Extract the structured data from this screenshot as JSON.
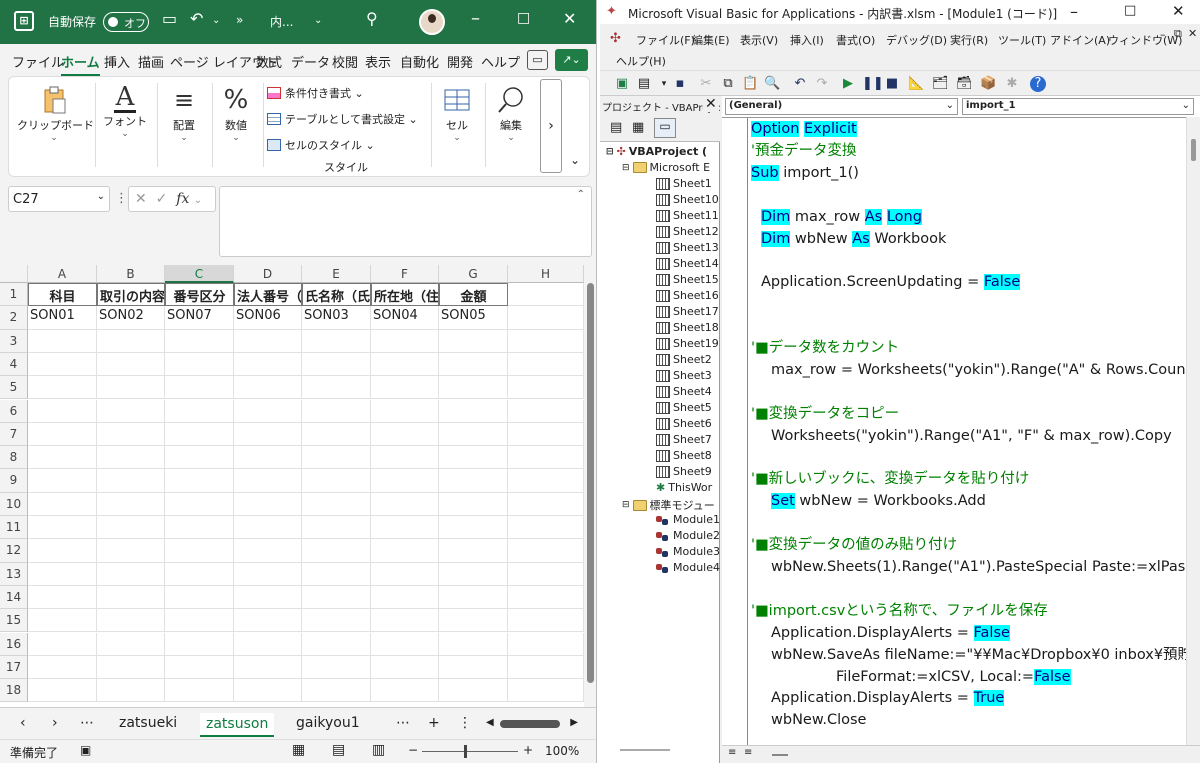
{
  "excel": {
    "logo_glyph": "⊞",
    "autosave_label": "自動保存",
    "autosave_state": "オフ",
    "title_short": "内...",
    "ribbon_tabs": [
      "ファイル",
      "ホーム",
      "挿入",
      "描画",
      "ページ レイアウト",
      "数式",
      "データ",
      "校閲",
      "表示",
      "自動化",
      "開発",
      "ヘルプ"
    ],
    "active_tab": "ホーム",
    "ribbon": {
      "clipboard": "クリップボード",
      "font": "フォント",
      "alignment": "配置",
      "number": "数値",
      "cond_format": "条件付き書式 ⌄",
      "table_format": "テーブルとして書式設定 ⌄",
      "cell_styles": "セルのスタイル ⌄",
      "styles_group": "スタイル",
      "cells": "セル",
      "editing": "編集"
    },
    "name_box": "C27",
    "fx_label": "fx",
    "columns": [
      "A",
      "B",
      "C",
      "D",
      "E",
      "F",
      "G",
      "H"
    ],
    "selected_column": "C",
    "rows": [
      "1",
      "2",
      "3",
      "4",
      "5",
      "6",
      "7",
      "8",
      "9",
      "10",
      "11",
      "12",
      "13",
      "14",
      "15",
      "16",
      "17",
      "18"
    ],
    "row1": [
      "科目",
      "取引の内容",
      "番号区分",
      "法人番号（法人",
      "氏名称（氏",
      "所在地（住",
      "金額"
    ],
    "row2": [
      "SON01",
      "SON02",
      "SON07",
      "SON06",
      "SON03",
      "SON04",
      "SON05"
    ],
    "sheet_tabs": [
      "zatsueki",
      "zatsuson",
      "gaikyou1"
    ],
    "active_sheet": "zatsuson",
    "status": "準備完了",
    "zoom": "100%"
  },
  "vba": {
    "title": "Microsoft Visual Basic for Applications - 内訳書.xlsm - [Module1 (コード)]",
    "menu_row1": [
      "ファイル(F)",
      "編集(E)",
      "表示(V)",
      "挿入(I)",
      "書式(O)",
      "デバッグ(D)",
      "実行(R)",
      "ツール(T)",
      "アドイン(A)",
      "ウィンドウ(W)"
    ],
    "menu_row2": [
      "ヘルプ(H)"
    ],
    "project_title": "プロジェクト - VBAProject",
    "tree": {
      "root": "VBAProject (",
      "excel_objects": "Microsoft E",
      "sheets": [
        "Sheet1",
        "Sheet10",
        "Sheet11",
        "Sheet12",
        "Sheet13",
        "Sheet14",
        "Sheet15",
        "Sheet16",
        "Sheet17",
        "Sheet18",
        "Sheet19",
        "Sheet2",
        "Sheet3",
        "Sheet4",
        "Sheet5",
        "Sheet6",
        "Sheet7",
        "Sheet8",
        "Sheet9",
        "ThisWor"
      ],
      "modules_folder": "標準モジュー",
      "modules": [
        "Module1",
        "Module2",
        "Module3",
        "Module4"
      ]
    },
    "object_combo": "(General)",
    "proc_combo": "import_1",
    "code_lines": [
      {
        "i": 0,
        "parts": [
          [
            "kw",
            "Option"
          ],
          [
            "t",
            " "
          ],
          [
            "kw",
            "Explicit"
          ]
        ]
      },
      {
        "i": 0,
        "parts": [
          [
            "cm",
            "'預金データ変換"
          ]
        ]
      },
      {
        "i": 0,
        "parts": [
          [
            "kw",
            "Sub"
          ],
          [
            "t",
            " import_1()"
          ]
        ]
      },
      {
        "i": 0,
        "parts": []
      },
      {
        "i": 1,
        "parts": [
          [
            "kw",
            "Dim"
          ],
          [
            "t",
            " max_row "
          ],
          [
            "kw",
            "As"
          ],
          [
            "t",
            " "
          ],
          [
            "kw",
            "Long"
          ]
        ]
      },
      {
        "i": 1,
        "parts": [
          [
            "kw",
            "Dim"
          ],
          [
            "t",
            " wbNew "
          ],
          [
            "kw",
            "As"
          ],
          [
            "t",
            " Workbook"
          ]
        ]
      },
      {
        "i": 0,
        "parts": []
      },
      {
        "i": 1,
        "parts": [
          [
            "t",
            "Application.ScreenUpdating = "
          ],
          [
            "kw",
            "False"
          ]
        ]
      },
      {
        "i": 0,
        "parts": []
      },
      {
        "i": 0,
        "parts": []
      },
      {
        "i": 0,
        "parts": [
          [
            "cm",
            "'■データ数をカウント"
          ]
        ]
      },
      {
        "i": 2,
        "parts": [
          [
            "t",
            "max_row = Worksheets(\"yokin\").Range(\"A\" & Rows.Coun"
          ]
        ]
      },
      {
        "i": 0,
        "parts": []
      },
      {
        "i": 0,
        "parts": [
          [
            "cm",
            "'■変換データをコピー"
          ]
        ]
      },
      {
        "i": 2,
        "parts": [
          [
            "t",
            "Worksheets(\"yokin\").Range(\"A1\", \"F\" & max_row).Copy"
          ]
        ]
      },
      {
        "i": 0,
        "parts": []
      },
      {
        "i": 0,
        "parts": [
          [
            "cm",
            "'■新しいブックに、変換データを貼り付け"
          ]
        ]
      },
      {
        "i": 2,
        "parts": [
          [
            "kw",
            "Set"
          ],
          [
            "t",
            " wbNew = Workbooks.Add"
          ]
        ]
      },
      {
        "i": 0,
        "parts": []
      },
      {
        "i": 0,
        "parts": [
          [
            "cm",
            "'■変換データの値のみ貼り付け"
          ]
        ]
      },
      {
        "i": 2,
        "parts": [
          [
            "t",
            "wbNew.Sheets(1).Range(\"A1\").PasteSpecial Paste:=xlPas"
          ]
        ]
      },
      {
        "i": 0,
        "parts": []
      },
      {
        "i": 0,
        "parts": [
          [
            "cm",
            "'■import.csvという名称で、ファイルを保存"
          ]
        ]
      },
      {
        "i": 2,
        "parts": [
          [
            "t",
            "Application.DisplayAlerts = "
          ],
          [
            "kw",
            "False"
          ]
        ]
      },
      {
        "i": 2,
        "parts": [
          [
            "t",
            "wbNew.SaveAs fileName:=\"¥¥Mac¥Dropbox¥0 inbox¥預貯"
          ]
        ]
      },
      {
        "i": 3,
        "parts": [
          [
            "t",
            "FileFormat:=xlCSV, Local:="
          ],
          [
            "kw",
            "False"
          ]
        ]
      },
      {
        "i": 2,
        "parts": [
          [
            "t",
            "Application.DisplayAlerts = "
          ],
          [
            "kw",
            "True"
          ]
        ]
      },
      {
        "i": 2,
        "parts": [
          [
            "t",
            "wbNew.Close"
          ]
        ]
      }
    ]
  }
}
